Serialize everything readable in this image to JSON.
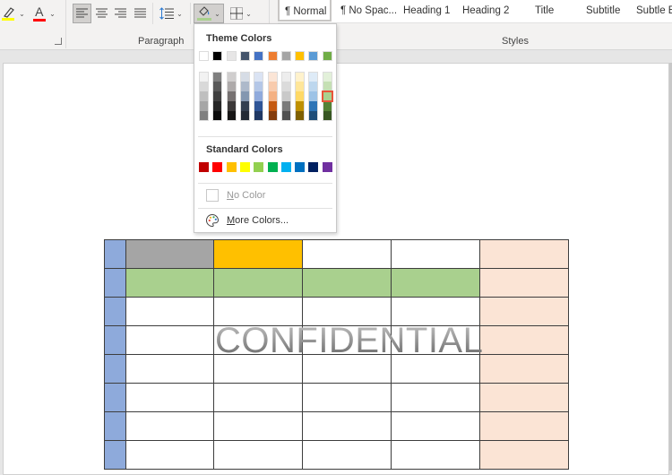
{
  "ribbon": {
    "font_group": {
      "highlight_color": "#ffff00",
      "font_color": "#ff0000",
      "font_color_letter": "A"
    },
    "paragraph_group": {
      "label": "Paragraph",
      "shading_bar_color": "#a9d08e"
    },
    "styles_group": {
      "label": "Styles",
      "items": [
        {
          "label": "¶ Normal",
          "selected": true
        },
        {
          "label": "¶ No Spac...",
          "selected": false
        },
        {
          "label": "Heading 1",
          "selected": false
        },
        {
          "label": "Heading 2",
          "selected": false
        },
        {
          "label": "Title",
          "selected": false
        },
        {
          "label": "Subtitle",
          "selected": false
        },
        {
          "label": "Subtle E",
          "selected": false
        }
      ]
    }
  },
  "shading_dropdown": {
    "theme_colors_heading": "Theme Colors",
    "theme_colors": [
      "#ffffff",
      "#000000",
      "#e7e6e6",
      "#44546a",
      "#4472c4",
      "#ed7d31",
      "#a5a5a5",
      "#ffc000",
      "#5b9bd5",
      "#70ad47"
    ],
    "theme_shades": [
      [
        "#f2f2f2",
        "#d9d9d9",
        "#bfbfbf",
        "#a6a6a6",
        "#808080"
      ],
      [
        "#7f7f7f",
        "#595959",
        "#404040",
        "#262626",
        "#0d0d0d"
      ],
      [
        "#d0cece",
        "#aeaaaa",
        "#767171",
        "#3b3838",
        "#171616"
      ],
      [
        "#d6dce5",
        "#adb9ca",
        "#8497b0",
        "#333f50",
        "#222a35"
      ],
      [
        "#dae3f3",
        "#b4c7e7",
        "#8faadc",
        "#2f5597",
        "#1f3864"
      ],
      [
        "#fbe5d6",
        "#f8cbad",
        "#f4b183",
        "#c55a11",
        "#843c0c"
      ],
      [
        "#ededed",
        "#dbdbdb",
        "#c9c9c9",
        "#7b7b7b",
        "#525252"
      ],
      [
        "#fff2cc",
        "#ffe699",
        "#ffd966",
        "#bf9000",
        "#7f6000"
      ],
      [
        "#deebf7",
        "#bdd7ee",
        "#9dc3e6",
        "#2e75b6",
        "#1f4e79"
      ],
      [
        "#e2f0d9",
        "#c5e0b4",
        "#a9d18e",
        "#548235",
        "#385723"
      ]
    ],
    "selected_swatch": {
      "column": 9,
      "row": 2
    },
    "standard_colors_heading": "Standard Colors",
    "standard_colors": [
      "#c00000",
      "#ff0000",
      "#ffc000",
      "#ffff00",
      "#92d050",
      "#00b050",
      "#00b0f0",
      "#0070c0",
      "#002060",
      "#7030a0"
    ],
    "no_color_label_prefix": "N",
    "no_color_label_rest": "o Color",
    "more_colors_label_prefix": "M",
    "more_colors_label_rest": "ore Colors..."
  },
  "document": {
    "watermark_text": "CONFIDENTIAL",
    "table": {
      "rows": [
        [
          "#8eaadb",
          "#a5a5a5",
          "#ffc000",
          "#ffffff",
          "#ffffff",
          "#fbe4d5"
        ],
        [
          "#8eaadb",
          "#a9d08e",
          "#a9d08e",
          "#a9d08e",
          "#a9d08e",
          "#fbe4d5"
        ],
        [
          "#8eaadb",
          "#ffffff",
          "#ffffff",
          "#ffffff",
          "#ffffff",
          "#fbe4d5"
        ],
        [
          "#8eaadb",
          "#ffffff",
          "#ffffff",
          "#ffffff",
          "#ffffff",
          "#fbe4d5"
        ],
        [
          "#8eaadb",
          "#ffffff",
          "#ffffff",
          "#ffffff",
          "#ffffff",
          "#fbe4d5"
        ],
        [
          "#8eaadb",
          "#ffffff",
          "#ffffff",
          "#ffffff",
          "#ffffff",
          "#fbe4d5"
        ],
        [
          "#8eaadb",
          "#ffffff",
          "#ffffff",
          "#ffffff",
          "#ffffff",
          "#fbe4d5"
        ],
        [
          "#8eaadb",
          "#ffffff",
          "#ffffff",
          "#ffffff",
          "#ffffff",
          "#fbe4d5"
        ]
      ]
    }
  }
}
